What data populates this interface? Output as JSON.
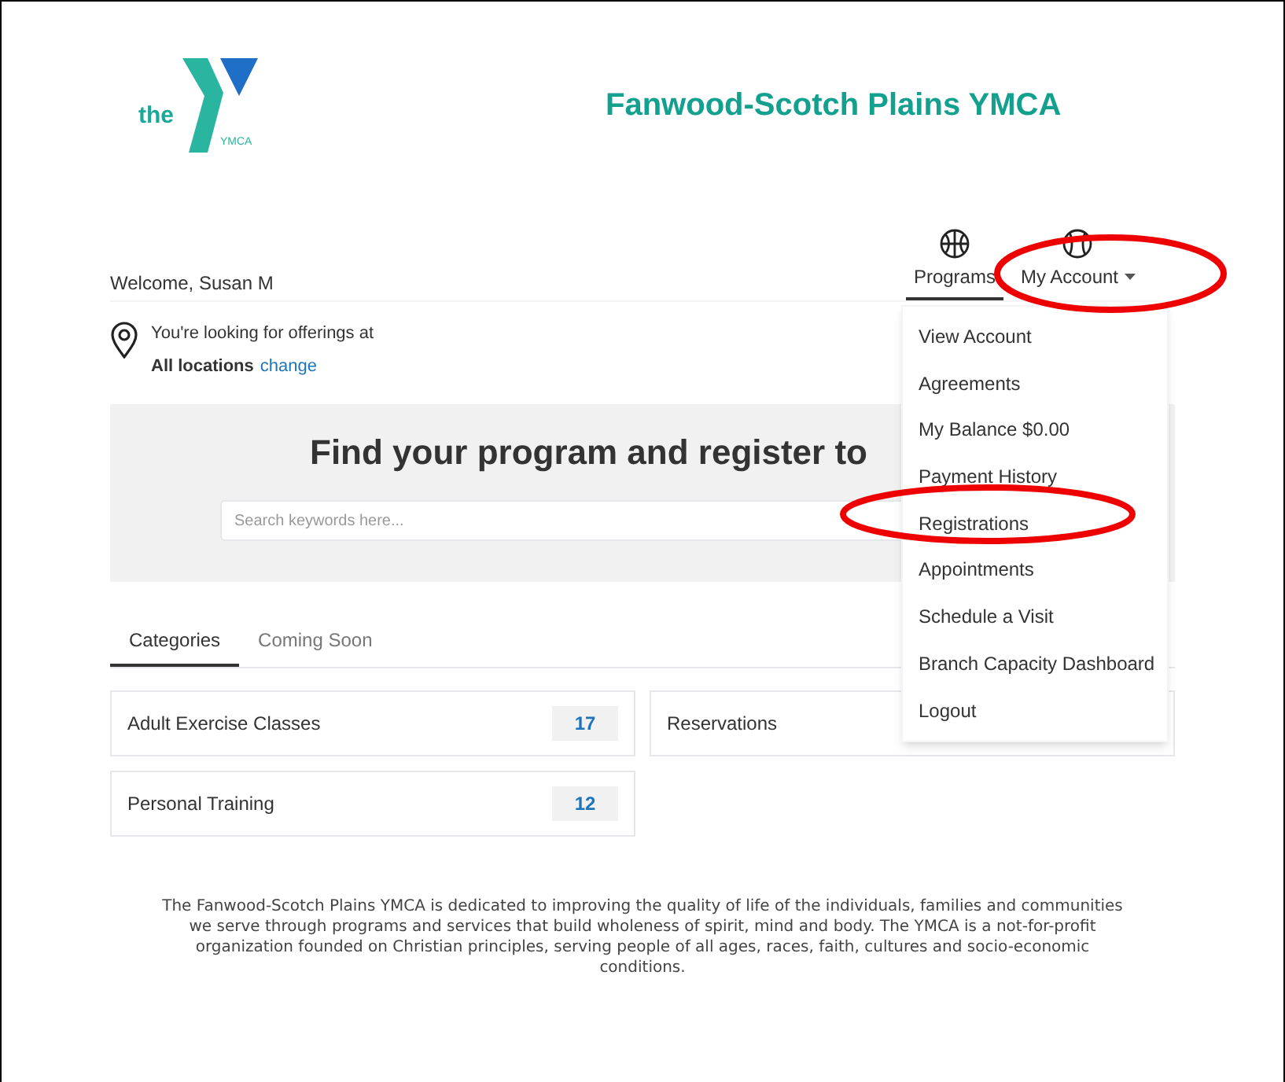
{
  "header": {
    "logo_word": "the",
    "logo_small": "YMCA",
    "title": "Fanwood-Scotch Plains YMCA"
  },
  "welcome": "Welcome, Susan M",
  "nav": [
    {
      "label": "Programs",
      "selected": true,
      "caret": false
    },
    {
      "label": "My Account",
      "selected": false,
      "caret": true
    }
  ],
  "location": {
    "line": "You're looking for offerings at",
    "place": "All locations",
    "link": "change"
  },
  "hero": {
    "title": "Find your program and register to",
    "search": {
      "placeholder": "Search keywords here..."
    }
  },
  "tabs": [
    {
      "label": "Categories",
      "selected": true
    },
    {
      "label": "Coming Soon",
      "selected": false
    }
  ],
  "categories": [
    {
      "name": "Adult Exercise Classes",
      "count": "17"
    },
    {
      "name": "Reservations"
    },
    {
      "name": "Personal Training",
      "count": "12"
    }
  ],
  "account_menu": {
    "expanded": true,
    "items": [
      "View Account",
      "Agreements",
      "My Balance $0.00",
      "Payment History",
      "Registrations",
      "Appointments",
      "Schedule a Visit",
      "Branch Capacity Dashboard",
      "Logout"
    ]
  },
  "about": "The Fanwood-Scotch Plains YMCA is dedicated to improving the quality of life of the individuals, families and communities we serve through programs and services that build wholeness of spirit, mind and body. The YMCA is a not-for-profit organization founded on Christian principles, serving people of all ages, races, faith, cultures and socio-economic conditions."
}
